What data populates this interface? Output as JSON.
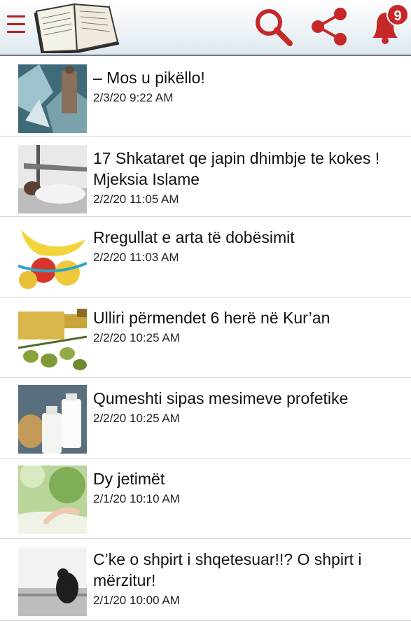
{
  "header": {
    "menu_icon": "hamburger-menu-icon",
    "logo_icon": "open-book-icon",
    "search_icon": "search-icon",
    "share_icon": "share-icon",
    "bell_icon": "bell-icon",
    "notification_count": "9",
    "accent_color": "#c62828"
  },
  "articles": [
    {
      "title": "– Mos u pikëllo!",
      "date": "2/3/20 9:22 AM"
    },
    {
      "title": "17 Shkataret qe japin dhimbje te kokes ! Mjeksia Islame",
      "date": "2/2/20 11:05 AM"
    },
    {
      "title": "Rregullat e arta të dobësimit",
      "date": "2/2/20 11:03 AM"
    },
    {
      "title": "Ulliri përmendet 6 herë në Kur’an",
      "date": "2/2/20 10:25 AM"
    },
    {
      "title": "Qumeshti sipas mesimeve profetike",
      "date": "2/2/20 10:25 AM"
    },
    {
      "title": "Dy jetimët",
      "date": "2/1/20 10:10 AM"
    },
    {
      "title": "C’ke o shpirt i shqetesuar!!? O shpirt i mërzitur!",
      "date": "2/1/20 10:00 AM"
    }
  ]
}
